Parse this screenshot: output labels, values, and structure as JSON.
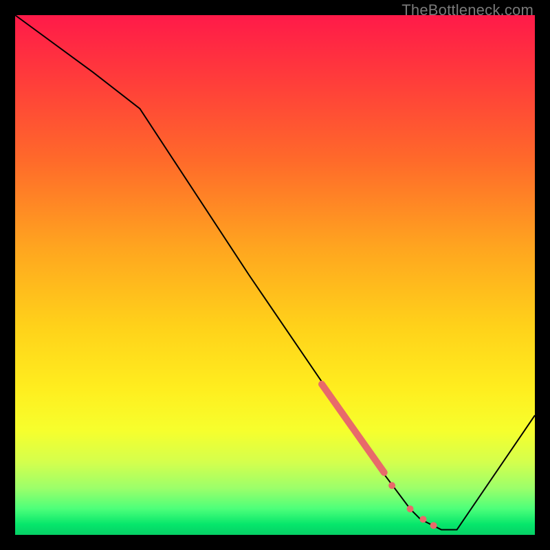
{
  "watermark": "TheBottleneck.com",
  "chart_data": {
    "type": "line",
    "title": "",
    "xlabel": "",
    "ylabel": "",
    "xlim": [
      0,
      100
    ],
    "ylim": [
      0,
      100
    ],
    "grid": false,
    "legend": false,
    "series": [
      {
        "name": "bottleneck-curve",
        "x": [
          0,
          15,
          24,
          45,
          60,
          70,
          76,
          78,
          82,
          85,
          100
        ],
        "y": [
          100,
          89,
          82,
          50,
          28,
          13,
          5,
          3,
          1,
          1,
          23
        ],
        "color": "#000000",
        "stroke_width": 2
      }
    ],
    "highlight_segment": {
      "color": "#e86a6a",
      "x": [
        59,
        71
      ],
      "y": [
        29,
        12
      ],
      "stroke_width": 10
    },
    "highlight_dots": {
      "color": "#e86a6a",
      "radius_px": 5,
      "points": [
        {
          "x": 72.5,
          "y": 9.5
        },
        {
          "x": 76.0,
          "y": 5.0
        },
        {
          "x": 78.5,
          "y": 3.0
        },
        {
          "x": 80.5,
          "y": 1.8
        }
      ]
    },
    "background_gradient": {
      "top": "#ff1a49",
      "bottom": "#06d066"
    }
  }
}
